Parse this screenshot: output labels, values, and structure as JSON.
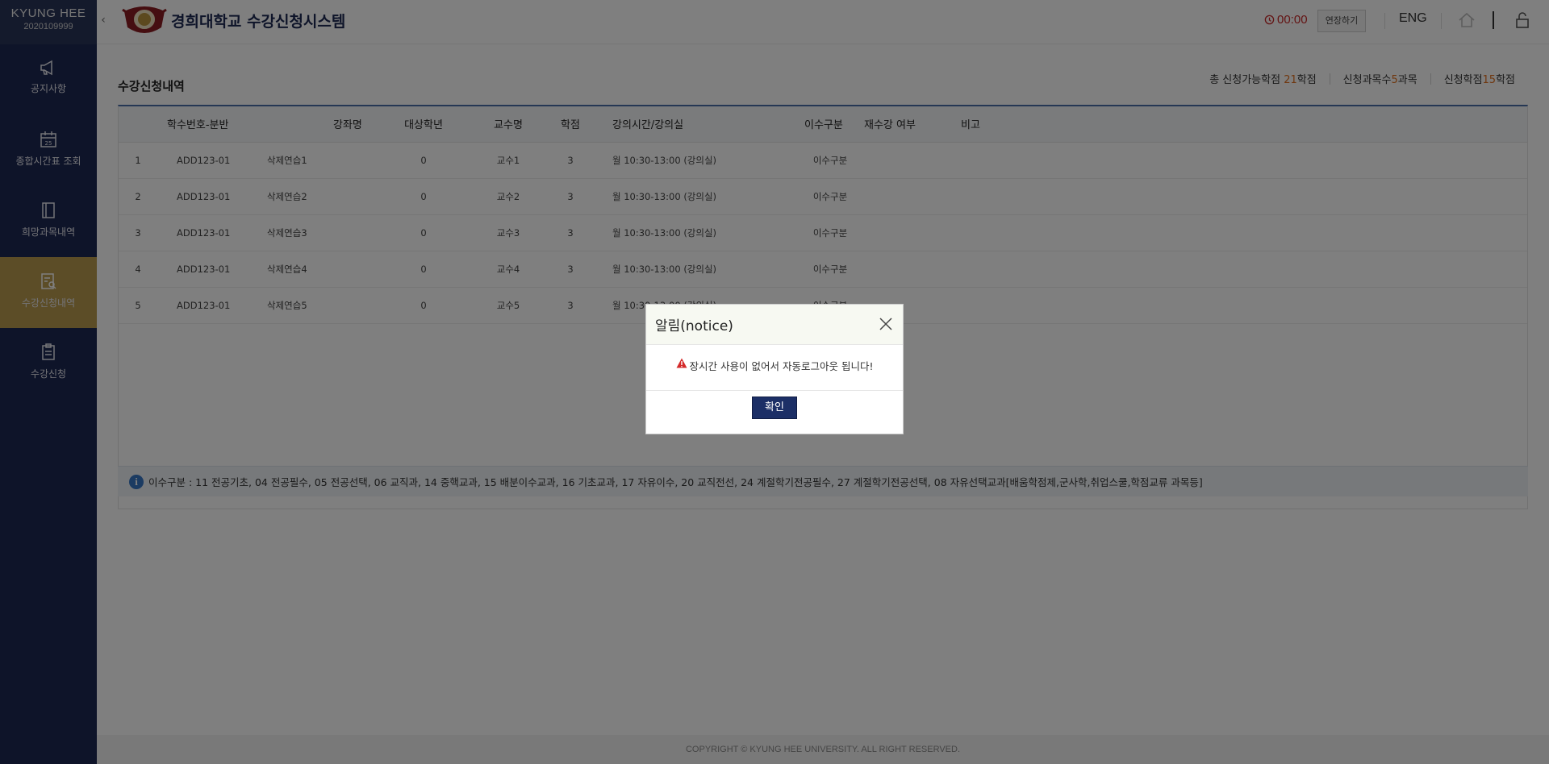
{
  "sidebar": {
    "brand_name": "KYUNG HEE",
    "student_id": "2020109999",
    "items": [
      {
        "label": "공지사항",
        "icon": "megaphone-icon"
      },
      {
        "label": "종합시간표 조회",
        "icon": "calendar-icon",
        "badge": "25"
      },
      {
        "label": "희망과목내역",
        "icon": "book-icon"
      },
      {
        "label": "수강신청내역",
        "icon": "document-search-icon",
        "active": true
      },
      {
        "label": "수강신청",
        "icon": "clipboard-icon"
      }
    ]
  },
  "header": {
    "title": "경희대학교 수강신청시스템",
    "timer": "00:00",
    "extend_label": "연장하기",
    "lang_label": "ENG"
  },
  "main": {
    "page_title": "수강신청내역",
    "summary": {
      "total_label_prefix": "총 신청가능학점 ",
      "total_value": "21",
      "total_suffix": "학점",
      "courses_prefix": "신청과목수",
      "courses_value": "5",
      "courses_suffix": "과목",
      "credits_prefix": "신청학점",
      "credits_value": "15",
      "credits_suffix": "학점"
    },
    "table": {
      "headers": {
        "no": "",
        "code": "학수번호-분반",
        "name": "강좌명",
        "grade": "대상학년",
        "prof": "교수명",
        "credit": "학점",
        "time": "강의시간/강의실",
        "type": "이수구분",
        "retake": "재수강 여부",
        "note": "비고"
      },
      "rows": [
        {
          "no": "1",
          "code": "ADD123-01",
          "name": "삭제연습1",
          "grade": "0",
          "prof": "교수1",
          "credit": "3",
          "time": "월 10:30-13:00 (강의실)",
          "type": "이수구분"
        },
        {
          "no": "2",
          "code": "ADD123-01",
          "name": "삭제연습2",
          "grade": "0",
          "prof": "교수2",
          "credit": "3",
          "time": "월 10:30-13:00 (강의실)",
          "type": "이수구분"
        },
        {
          "no": "3",
          "code": "ADD123-01",
          "name": "삭제연습3",
          "grade": "0",
          "prof": "교수3",
          "credit": "3",
          "time": "월 10:30-13:00 (강의실)",
          "type": "이수구분"
        },
        {
          "no": "4",
          "code": "ADD123-01",
          "name": "삭제연습4",
          "grade": "0",
          "prof": "교수4",
          "credit": "3",
          "time": "월 10:30-13:00 (강의실)",
          "type": "이수구분"
        },
        {
          "no": "5",
          "code": "ADD123-01",
          "name": "삭제연습5",
          "grade": "0",
          "prof": "교수5",
          "credit": "3",
          "time": "월 10:30-13:00 (강의실)",
          "type": "이수구분"
        }
      ]
    },
    "legend": "이수구분 : 11 전공기초, 04 전공필수, 05 전공선택, 06 교직과, 14 중핵교과, 15 배분이수교과, 16 기초교과, 17 자유이수, 20 교직전선, 24 계절학기전공필수, 27 계절학기전공선택, 08 자유선택교과[배움학점제,군사학,취업스쿨,학점교류 과목등]"
  },
  "footer": {
    "copyright": "COPYRIGHT © KYUNG HEE UNIVERSITY. ALL RIGHT RESERVED."
  },
  "modal": {
    "title": "알림(notice)",
    "message": "장시간 사용이 없어서 자동로그아웃 됩니다!",
    "ok_label": "확인"
  },
  "colors": {
    "sidebar": "#1c2852",
    "active": "#b89a4e",
    "accent_num": "#e07020",
    "timer": "#c82828",
    "button": "#1c2f66"
  }
}
